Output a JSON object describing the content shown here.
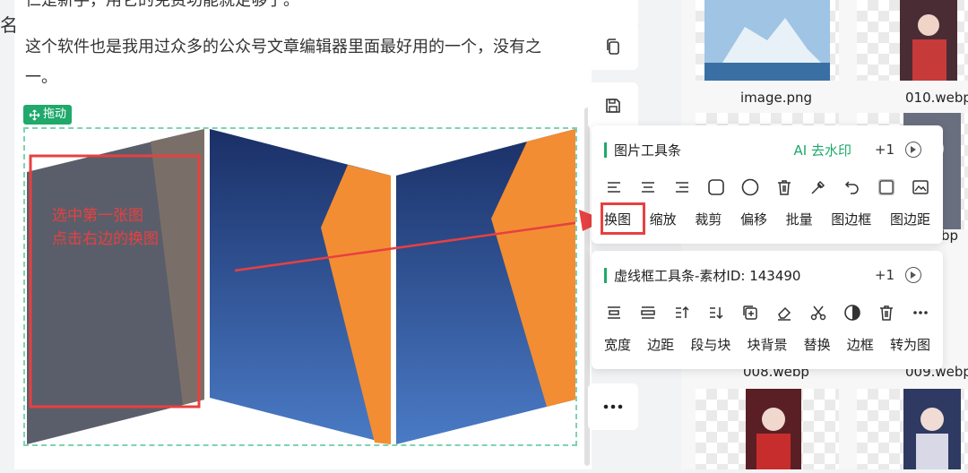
{
  "editor": {
    "top_text": "仁是新手，用它的免费功能就足够了。",
    "paragraph": "这个软件也是我用过众多的公众号文章编辑器里面最好用的一个，没有之一。",
    "drag_label": "拖动",
    "annotation_line1": "选中第一张图",
    "annotation_line2": "点击右边的换图",
    "edge_char": "名"
  },
  "gallery": {
    "labels": [
      "image.png",
      "010.webp",
      "008.webp",
      "009.webp"
    ],
    "partial_label": "bp"
  },
  "image_toolbar": {
    "title": "图片工具条",
    "ai_label": "AI 去水印",
    "count": "+1",
    "icons": [
      "align-left-icon",
      "align-center-icon",
      "align-right-icon",
      "rounded-square-icon",
      "circle-icon",
      "trash-icon",
      "eyedropper-icon",
      "undo-icon",
      "shadow-square-icon",
      "image-icon"
    ],
    "labels": [
      "换图",
      "缩放",
      "裁剪",
      "偏移",
      "批量",
      "图边框",
      "图边距"
    ]
  },
  "dashed_toolbar": {
    "title": "虚线框工具条-素材ID: 143490",
    "count": "+1",
    "icons": [
      "width-icon",
      "margin-icon",
      "paragraph-up-icon",
      "paragraph-down-icon",
      "copy-add-icon",
      "eraser-icon",
      "scissors-icon",
      "contrast-icon",
      "trash-icon",
      "more-icon"
    ],
    "labels": [
      "宽度",
      "边距",
      "段与块",
      "块背景",
      "替换",
      "边框",
      "转为图"
    ]
  },
  "colors": {
    "accent_green": "#1fa96b",
    "annotation_red": "#e84040",
    "panel_navy": "#1f3a73",
    "panel_orange": "#f08a2f"
  }
}
